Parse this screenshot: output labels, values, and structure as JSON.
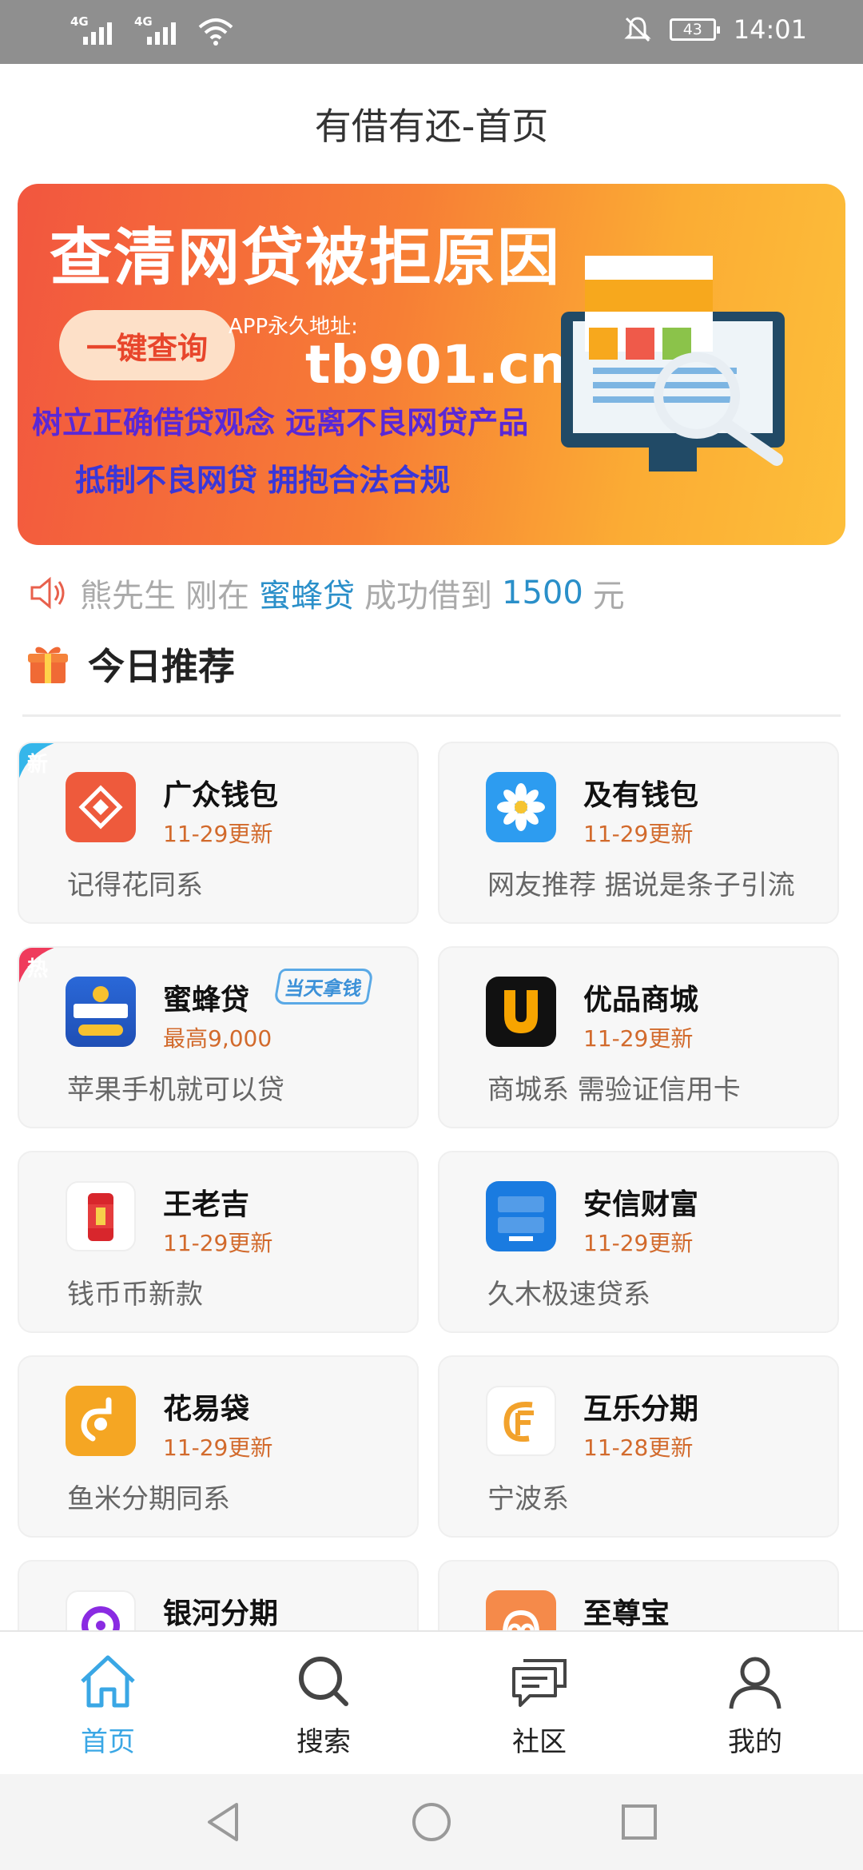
{
  "status": {
    "sig1": "4G",
    "sig2": "4G",
    "battery": "43",
    "time": "14:01"
  },
  "header": {
    "title": "有借有还-首页"
  },
  "banner": {
    "title": "查清网贷被拒原因",
    "button": "一键查询",
    "app_label": "APP永久地址:",
    "url": "tb901.cn",
    "line1": "树立正确借贷观念 远离不良网贷产品",
    "line2": "抵制不良网贷 拥抱合法合规"
  },
  "notice": {
    "user": "熊先生",
    "just": "刚在",
    "product": "蜜蜂贷",
    "success": "成功借到",
    "amount": "1500",
    "unit": "元"
  },
  "section": {
    "title": "今日推荐"
  },
  "cards": [
    {
      "name": "广众钱包",
      "sub": "11-29更新",
      "desc": "记得花同系",
      "tag": "新"
    },
    {
      "name": "及有钱包",
      "sub": "11-29更新",
      "desc": "网友推荐 据说是条子引流"
    },
    {
      "name": "蜜蜂贷",
      "sub": "最高9,000",
      "desc": "苹果手机就可以贷",
      "tag": "热",
      "badge": "当天拿钱"
    },
    {
      "name": "优品商城",
      "sub": "11-29更新",
      "desc": "商城系 需验证信用卡"
    },
    {
      "name": "王老吉",
      "sub": "11-29更新",
      "desc": "钱币币新款"
    },
    {
      "name": "安信财富",
      "sub": "11-29更新",
      "desc": "久木极速贷系"
    },
    {
      "name": "花易袋",
      "sub": "11-29更新",
      "desc": "鱼米分期同系"
    },
    {
      "name": "互乐分期",
      "sub": "11-28更新",
      "desc": "宁波系"
    },
    {
      "name": "银河分期"
    },
    {
      "name": "至尊宝"
    }
  ],
  "tabs": [
    {
      "label": "首页",
      "icon": "home-icon"
    },
    {
      "label": "搜索",
      "icon": "search-icon"
    },
    {
      "label": "社区",
      "icon": "chat-icon"
    },
    {
      "label": "我的",
      "icon": "user-icon"
    }
  ],
  "colors": {
    "accent": "#3aa7e5",
    "update_text": "#d26a2c",
    "new_tag": "#35b6ea",
    "hot_tag": "#ef3b5c"
  }
}
